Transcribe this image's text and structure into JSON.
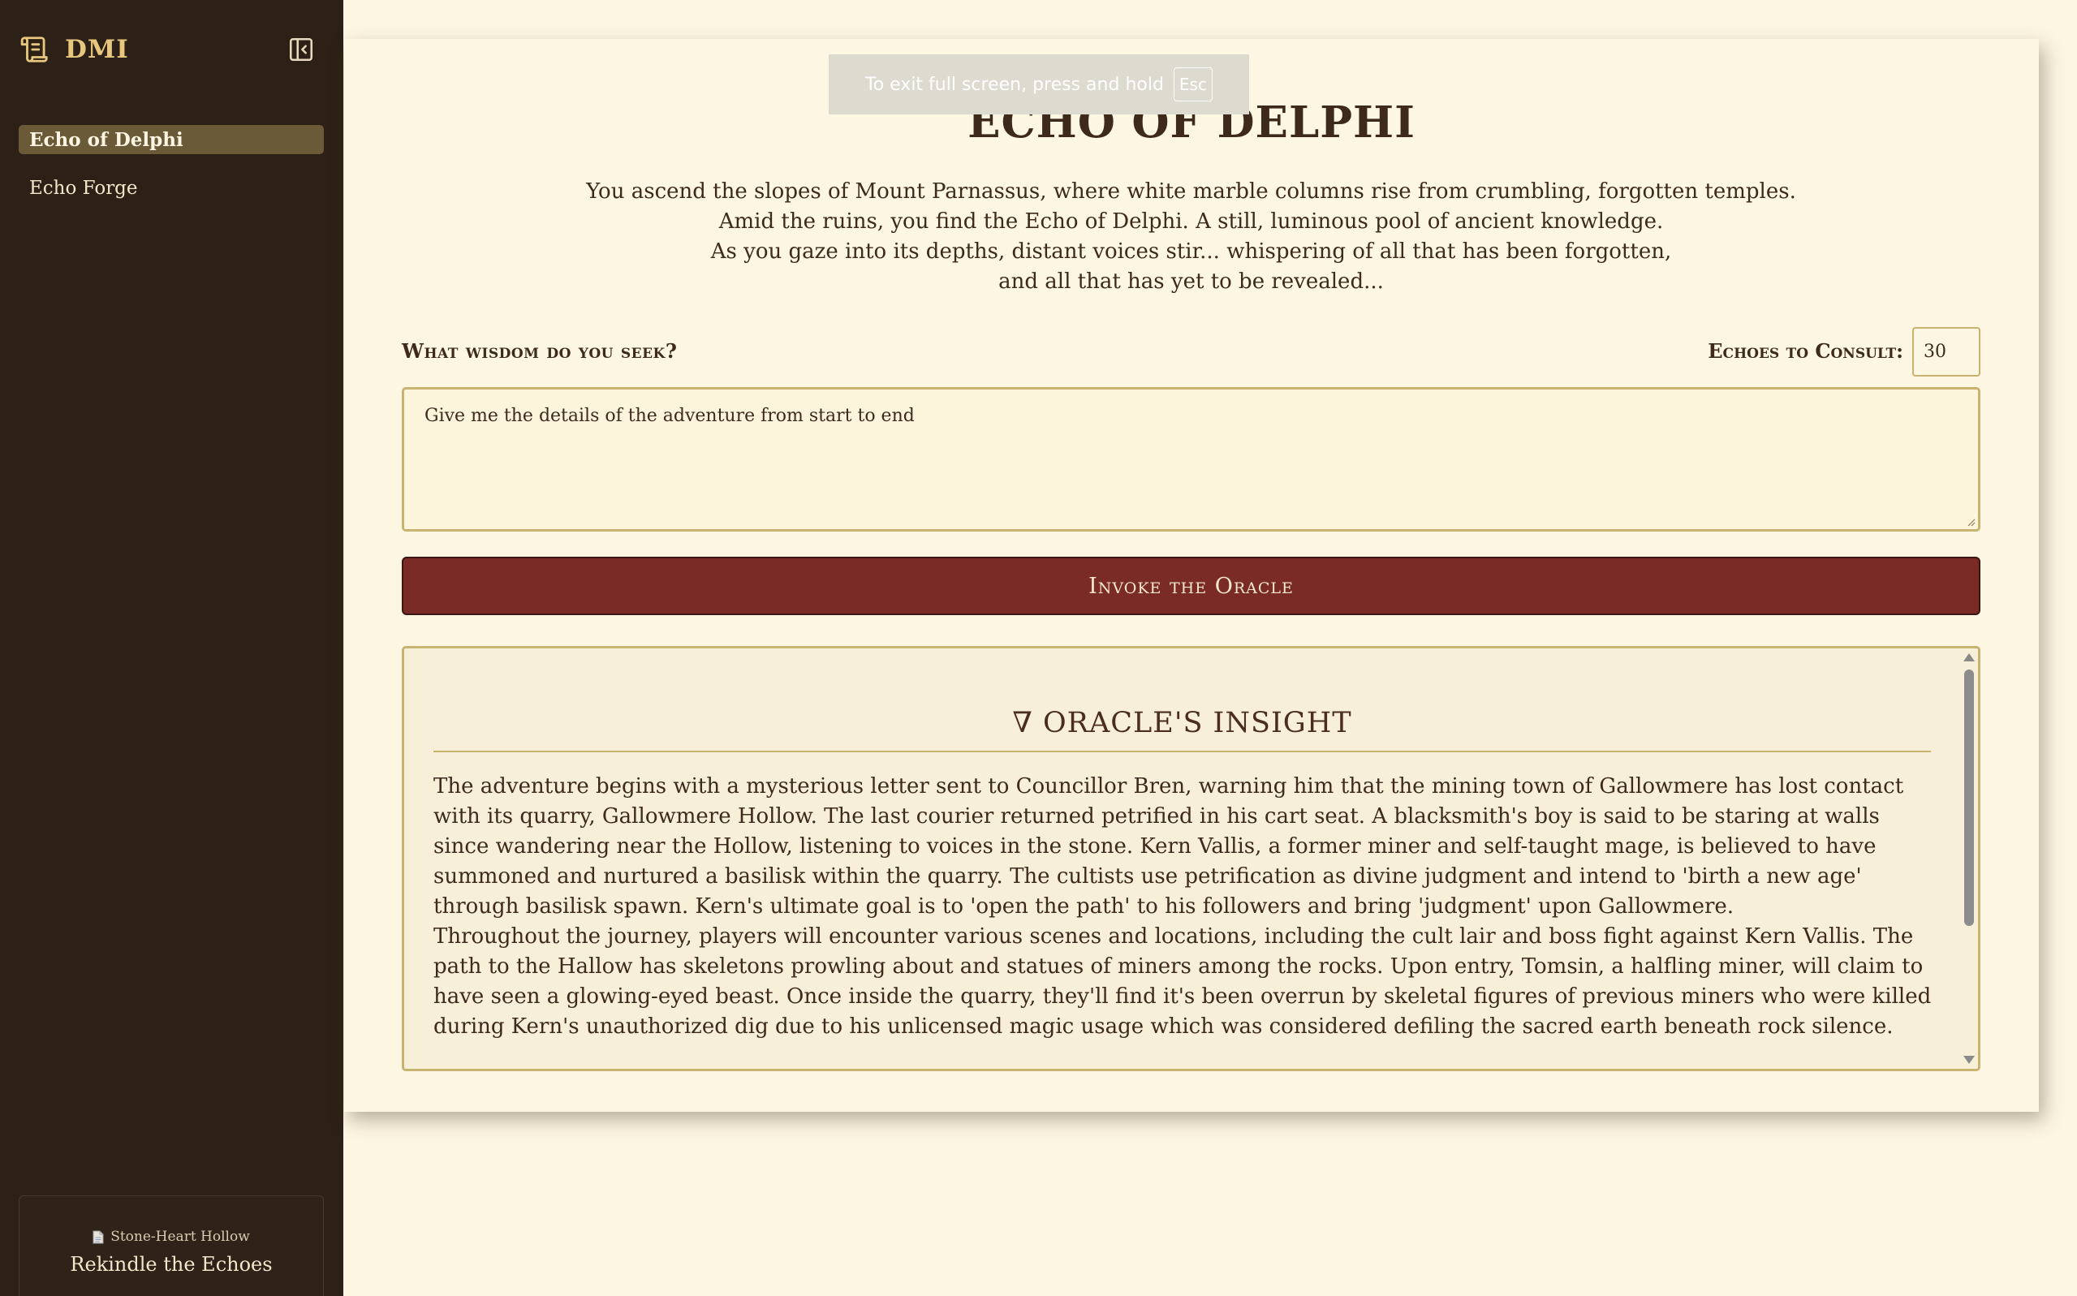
{
  "sidebar": {
    "brand": "DMI",
    "brand_icon": "scroll-icon",
    "collapse_icon": "collapse-sidebar-icon",
    "items": [
      {
        "label": "Echo of Delphi",
        "active": true
      },
      {
        "label": "Echo Forge",
        "active": false
      }
    ],
    "footer": {
      "icon": "document-icon",
      "subtitle": "Stone-Heart Hollow",
      "title": "Rekindle the Echoes"
    }
  },
  "toast": {
    "text": "To exit full screen, press and hold",
    "key": "Esc"
  },
  "main": {
    "title": "ECHO OF DELPHI",
    "intro": [
      "You ascend the slopes of Mount Parnassus, where white marble columns rise from crumbling, forgotten temples.",
      "Amid the ruins, you find the Echo of Delphi. A still, luminous pool of ancient knowledge.",
      "As you gaze into its depths, distant voices stir... whispering of all that has been forgotten,",
      "and all that has yet to be revealed..."
    ],
    "seek_label": "What wisdom do you seek?",
    "echoes_label": "Echoes to Consult:",
    "echoes_value": "30",
    "query": "Give me the details of the adventure from start to end",
    "invoke_label": "Invoke the Oracle"
  },
  "insight": {
    "marker": "∇",
    "title": "ORACLE'S INSIGHT",
    "paragraphs": [
      "The adventure begins with a mysterious letter sent to Councillor Bren, warning him that the mining town of Gallowmere has lost contact with its quarry, Gallowmere Hollow. The last courier returned petrified in his cart seat. A blacksmith's boy is said to be staring at walls since wandering near the Hollow, listening to voices in the stone. Kern Vallis, a former miner and self-taught mage, is believed to have summoned and nurtured a basilisk within the quarry. The cultists use petrification as divine judgment and intend to 'birth a new age' through basilisk spawn. Kern's ultimate goal is to 'open the path' to his followers and bring 'judgment' upon Gallowmere.",
      "Throughout the journey, players will encounter various scenes and locations, including the cult lair and boss fight against Kern Vallis. The path to the Hallow has skeletons prowling about and statues of miners among the rocks. Upon entry, Tomsin, a halfling miner, will claim to have seen a glowing-eyed beast. Once inside the quarry, they'll find it's been overrun by skeletal figures of previous miners who were killed during Kern's unauthorized dig due to his unlicensed magic usage which was considered defiling the sacred earth beneath rock silence."
    ]
  },
  "colors": {
    "sidebar_bg": "#2d2016",
    "brand": "#e7c77e",
    "accent_button": "#7b2b26",
    "border_gold": "#c8b370",
    "page_bg": "#fdf6e3"
  }
}
